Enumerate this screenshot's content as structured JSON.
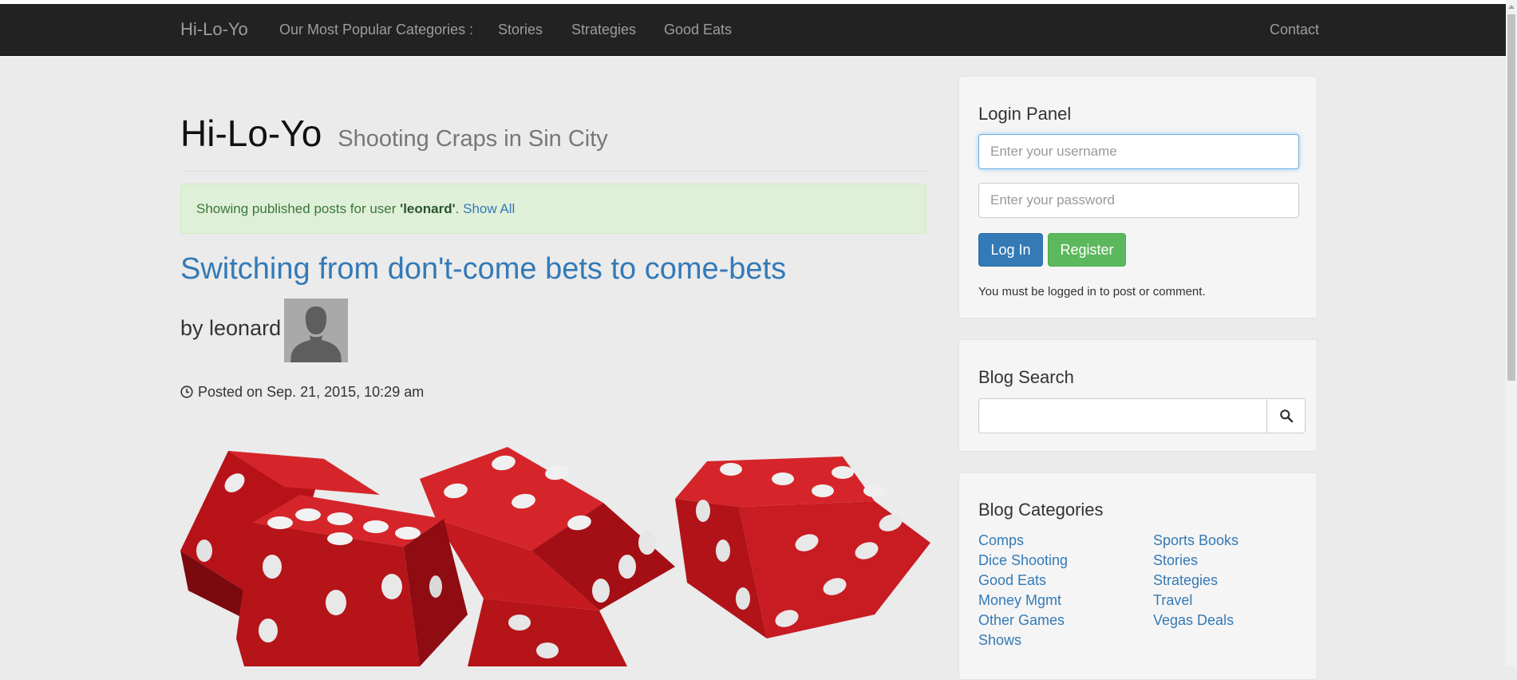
{
  "navbar": {
    "brand": "Hi-Lo-Yo",
    "categories_label": "Our Most Popular Categories :",
    "links": [
      "Stories",
      "Strategies",
      "Good Eats"
    ],
    "contact": "Contact"
  },
  "page_header": {
    "title": "Hi-Lo-Yo",
    "subtitle": "Shooting Craps in Sin City"
  },
  "alert": {
    "prefix": "Showing published posts for user ",
    "user": "'leonard'",
    "separator": ".",
    "show_all": "Show All"
  },
  "post": {
    "title": "Switching from don't-come bets to come-bets",
    "byline": "by leonard",
    "posted": "Posted on Sep. 21, 2015, 10:29 am"
  },
  "login_panel": {
    "title": "Login Panel",
    "username_placeholder": "Enter your username",
    "password_placeholder": "Enter your password",
    "login_label": "Log In",
    "register_label": "Register",
    "note": "You must be logged in to post or comment."
  },
  "blog_search": {
    "title": "Blog Search",
    "value": ""
  },
  "blog_categories": {
    "title": "Blog Categories",
    "left": [
      "Comps",
      "Dice Shooting",
      "Good Eats",
      "Money Mgmt",
      "Other Games",
      "Shows"
    ],
    "right": [
      "Sports Books",
      "Stories",
      "Strategies",
      "Travel",
      "Vegas Deals"
    ]
  },
  "colors": {
    "navbar": "#222222",
    "link": "#337ab7",
    "success_bg": "#dff0d8",
    "primary": "#337ab7",
    "success": "#5cb85c",
    "dice_red": "#c4161c"
  },
  "icons": {
    "clock": "clock-icon",
    "search": "search-icon",
    "avatar": "user-silhouette-icon"
  }
}
